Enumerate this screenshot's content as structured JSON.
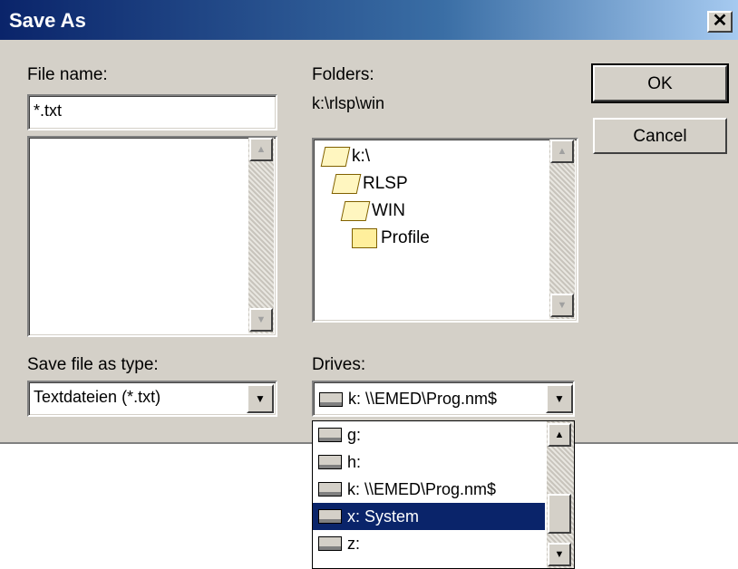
{
  "window": {
    "title": "Save As",
    "close_glyph": "✕"
  },
  "file_name": {
    "label": "File name:",
    "value": "*.txt",
    "list_items": []
  },
  "folders": {
    "label": "Folders:",
    "current_path": "k:\\rlsp\\win",
    "tree": [
      {
        "name": "k:\\",
        "icon": "open-folder-icon"
      },
      {
        "name": "RLSP",
        "icon": "open-folder-icon"
      },
      {
        "name": "WIN",
        "icon": "open-folder-icon"
      },
      {
        "name": "Profile",
        "icon": "folder-icon"
      }
    ]
  },
  "buttons": {
    "ok": "OK",
    "cancel": "Cancel"
  },
  "save_type": {
    "label": "Save file as type:",
    "selected": "Textdateien (*.txt)"
  },
  "drives": {
    "label": "Drives:",
    "selected": "k: \\\\EMED\\Prog.nm$",
    "options": [
      {
        "label": "g:",
        "icon": "drive-icon",
        "selected": false
      },
      {
        "label": "h:",
        "icon": "drive-icon",
        "selected": false
      },
      {
        "label": "k: \\\\EMED\\Prog.nm$",
        "icon": "network-drive-icon",
        "selected": false
      },
      {
        "label": "x: System",
        "icon": "drive-icon",
        "selected": true
      },
      {
        "label": "z:",
        "icon": "drive-icon",
        "selected": false
      }
    ]
  },
  "icons": {
    "scroll_up": "▲",
    "scroll_down": "▼"
  },
  "colors": {
    "selection": "#0a246a",
    "title_bar": "#0a246a",
    "dialog_bg": "#d4d0c8"
  }
}
